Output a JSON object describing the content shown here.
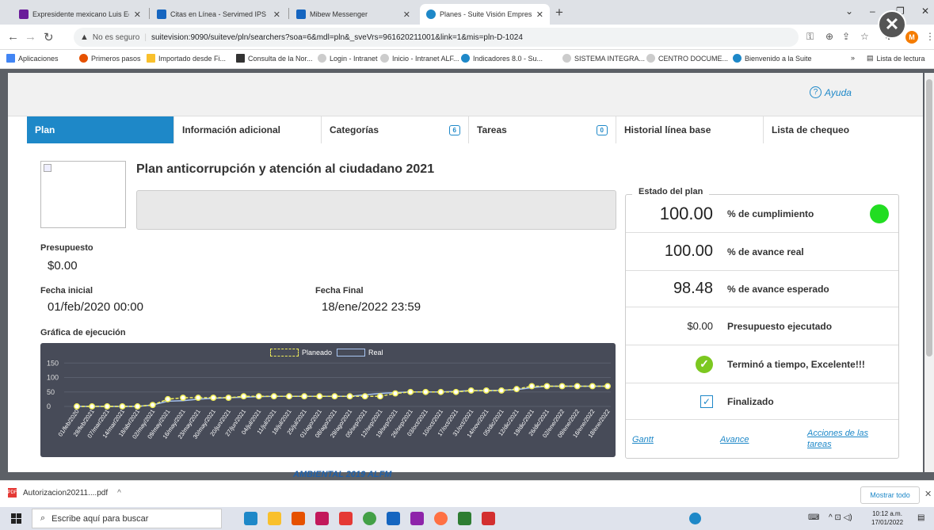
{
  "browser": {
    "tabs": [
      {
        "title": "Expresidente mexicano Luis Eche",
        "color": "#6a1b9a"
      },
      {
        "title": "Citas en Línea - Servimed IPS S.A",
        "color": "#1565c0"
      },
      {
        "title": "Mibew Messenger",
        "color": "#1565c0"
      },
      {
        "title": "Planes - Suite Visión Empresarial",
        "color": "#1e88c8"
      }
    ],
    "active_tab": 3,
    "address": {
      "security": "No es seguro",
      "url": "suitevision:9090/suiteve/pln/searchers?soa=6&mdl=pln&_sveVrs=961620211001&link=1&mis=pln-D-1024"
    },
    "profile_initial": "M",
    "bookmarks": [
      "Aplicaciones",
      "Primeros pasos",
      "Importado desde Fi...",
      "Consulta de la Nor...",
      "Login - Intranet",
      "Inicio - Intranet ALF...",
      "Indicadores 8.0 - Su...",
      "SISTEMA INTEGRA...",
      "CENTRO DOCUME...",
      "Bienvenido a la Suite"
    ],
    "reading_list": "Lista de lectura",
    "more": "»"
  },
  "header": {
    "help_label": "Ayuda"
  },
  "tabs": [
    {
      "label": "Plan",
      "badge": ""
    },
    {
      "label": "Información adicional",
      "badge": ""
    },
    {
      "label": "Categorías",
      "badge": "6"
    },
    {
      "label": "Tareas",
      "badge": "0"
    },
    {
      "label": "Historial línea base",
      "badge": ""
    },
    {
      "label": "Lista de chequeo",
      "badge": ""
    }
  ],
  "plan": {
    "title": "Plan anticorrupción y atención al ciudadano 2021",
    "description": "",
    "budget_label": "Presupuesto",
    "budget": "$0.00",
    "start_label": "Fecha inicial",
    "start": "01/feb/2020 00:00",
    "end_label": "Fecha Final",
    "end": "18/ene/2022 23:59",
    "chart_label": "Gráfica de ejecución"
  },
  "estado": {
    "title": "Estado del plan",
    "cumplimiento_value": "100.00",
    "cumplimiento_label": "% de cumplimiento",
    "avance_real_value": "100.00",
    "avance_real_label": "% de avance real",
    "avance_esperado_value": "98.48",
    "avance_esperado_label": "% de avance esperado",
    "presupuesto_value": "$0.00",
    "presupuesto_label": "Presupuesto ejecutado",
    "status_text": "Terminó a tiempo, Excelente!!!",
    "finalizado_label": "Finalizado",
    "links": {
      "gantt": "Gantt",
      "avance": "Avance",
      "acciones": "Acciones de las tareas"
    },
    "status_color": "#22dd22"
  },
  "background": {
    "behind_text": "AMBIENTAL 2019 ALFM"
  },
  "download": {
    "file": "Autorizacion20211....pdf",
    "show_all": "Mostrar todo"
  },
  "taskbar": {
    "search_placeholder": "Escribe aquí para buscar",
    "time": "10:12 a.m.",
    "date": "17/01/2022"
  },
  "chart_data": {
    "type": "line",
    "categories": [
      "01/feb/2020",
      "28/feb/2021",
      "07/mar/2021",
      "14/mar/2021",
      "18/abr/2021",
      "02/may/2021",
      "09/may/2021",
      "16/may/2021",
      "23/may/2021",
      "30/may/2021",
      "20/jun/2021",
      "27/jun/2021",
      "04/jul/2021",
      "11/jul/2021",
      "18/jul/2021",
      "25/jul/2021",
      "01/ago/2021",
      "08/ago/2021",
      "29/ago/2021",
      "05/sep/2021",
      "12/sep/2021",
      "19/sep/2021",
      "26/sep/2021",
      "03/oct/2021",
      "10/oct/2021",
      "17/oct/2021",
      "31/oct/2021",
      "14/nov/2021",
      "05/dic/2021",
      "12/dic/2021",
      "19/dic/2021",
      "26/dic/2021",
      "02/ene/2022",
      "09/ene/2022",
      "16/ene/2022",
      "18/ene/2022"
    ],
    "series": [
      {
        "name": "Planeado",
        "values": [
          0,
          0,
          0,
          0,
          0,
          5,
          25,
          30,
          30,
          30,
          30,
          35,
          35,
          35,
          35,
          35,
          35,
          35,
          35,
          35,
          35,
          45,
          50,
          50,
          50,
          50,
          55,
          55,
          55,
          60,
          70,
          70,
          70,
          70,
          70,
          70
        ]
      },
      {
        "name": "Real",
        "values": [
          0,
          0,
          0,
          0,
          0,
          5,
          18,
          20,
          25,
          28,
          30,
          32,
          34,
          35,
          35,
          35,
          35,
          35,
          35,
          40,
          45,
          48,
          50,
          50,
          50,
          52,
          55,
          55,
          56,
          58,
          65,
          70,
          70,
          70,
          70,
          70
        ]
      }
    ],
    "yticks": [
      0,
      50,
      100,
      150
    ],
    "ylim": [
      0,
      170
    ],
    "colors": {
      "planeado": "#f2ef5a",
      "real": "#a9c6f3"
    },
    "legend": "top-center"
  }
}
